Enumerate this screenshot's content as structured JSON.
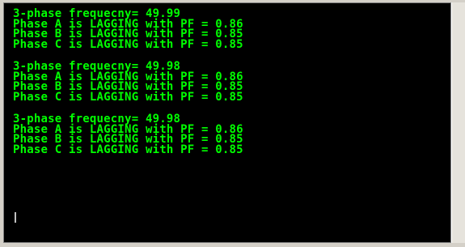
{
  "console": {
    "blocks": [
      {
        "freq_line": "3-phase frequecny= 49.99",
        "phase_a": "Phase A is LAGGING with PF = 0.86",
        "phase_b": "Phase B is LAGGING with PF = 0.85",
        "phase_c": "Phase C is LAGGING with PF = 0.85"
      },
      {
        "freq_line": "3-phase frequecny= 49.98",
        "phase_a": "Phase A is LAGGING with PF = 0.86",
        "phase_b": "Phase B is LAGGING with PF = 0.85",
        "phase_c": "Phase C is LAGGING with PF = 0.85"
      },
      {
        "freq_line": "3-phase frequecny= 49.98",
        "phase_a": "Phase A is LAGGING with PF = 0.86",
        "phase_b": "Phase B is LAGGING with PF = 0.85",
        "phase_c": "Phase C is LAGGING with PF = 0.85"
      }
    ],
    "text_color": "#00ff00",
    "background_color": "#000000"
  }
}
